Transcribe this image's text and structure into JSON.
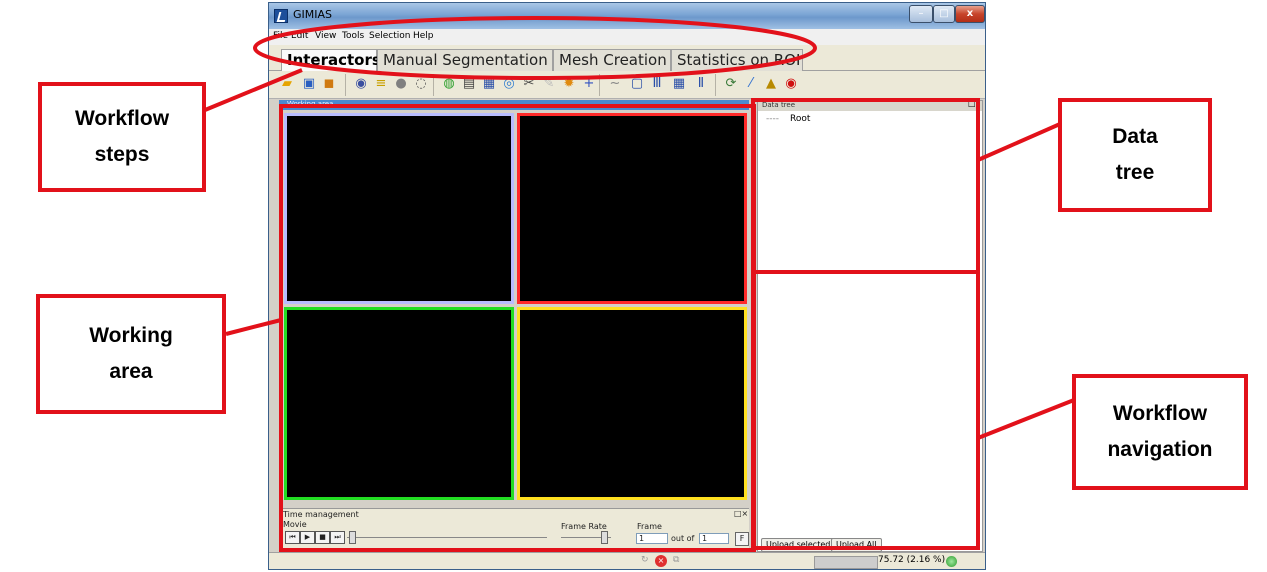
{
  "window": {
    "title": "GIMIAS",
    "min": "–",
    "max": "□",
    "close": "x"
  },
  "menu": [
    "File",
    "Edit",
    "View",
    "Tools",
    "Selection",
    "Help"
  ],
  "tabs": [
    "Interactors",
    "Manual Segmentation",
    "Mesh Creation",
    "Statistics on ROI"
  ],
  "working_area": {
    "title": "Working area",
    "view_borders": [
      "#b8bcff",
      "#ff2a2a",
      "#22dd22",
      "#ffe020"
    ]
  },
  "time_management": {
    "title": "Time management",
    "movie_label": "Movie",
    "frame_rate_label": "Frame Rate",
    "frame_label": "Frame",
    "frame_value": "1",
    "out_of": "out of",
    "total_frames": "1",
    "f_button": "F",
    "controls": [
      "⏮",
      "▶",
      "■",
      "⏭"
    ]
  },
  "data_tree": {
    "title": "Data tree",
    "root_label": "Root",
    "upload_selected": "Upload selected",
    "upload_all": "Upload All"
  },
  "status": {
    "memory": "75.72 (2.16 %)"
  },
  "annotations": {
    "workflow_steps": [
      "Workflow",
      "steps"
    ],
    "working_area": [
      "Working",
      "area"
    ],
    "data_tree": [
      "Data",
      "tree"
    ],
    "workflow_navigation": [
      "Workflow",
      "navigation"
    ]
  },
  "colors": {
    "annotation_red": "#e2111a",
    "titlebar_blue": "#7aa4d4",
    "panel_header_blue": "#4a8ad0"
  }
}
